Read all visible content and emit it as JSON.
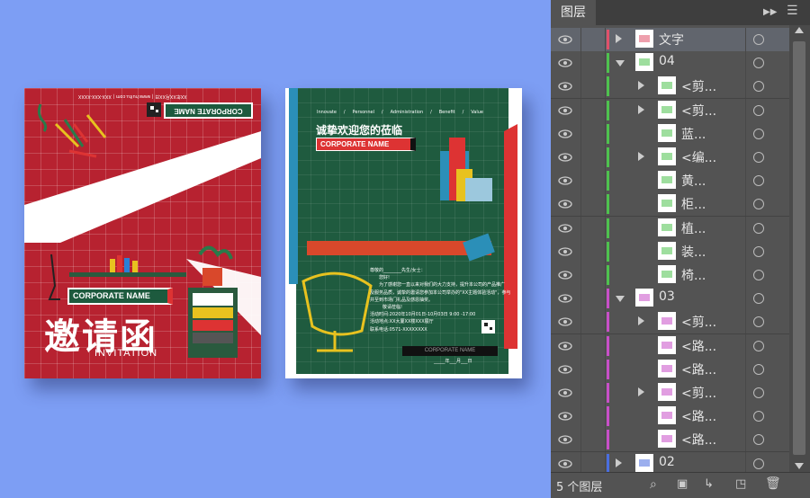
{
  "colors": {
    "background": "#7d9ef4",
    "red_card": "#b72230",
    "green_card": "#1f5b3f",
    "panel": "#535353"
  },
  "card_red": {
    "top_meta": "XX年XX月XX日 | www.huitu.com | XXX-XXX-XXXX",
    "corporate_label": "CORPORATE NAME",
    "corporate_label_2": "CORPORATE NAME",
    "title": "邀请函",
    "subtitle": "INVITATION"
  },
  "card_green": {
    "nav": [
      "Innovate",
      "/",
      "Personnel",
      "/",
      "Administration",
      "/",
      "Benefit",
      "/",
      "Value"
    ],
    "heading": "诚挚欢迎您的莅临",
    "corporate_label": "CORPORATE NAME",
    "body_lines": [
      "尊敬的________先生/女士：",
      "您好!",
      "为了感谢您一直以来对我们的大力支持，提升本公司的产品推广",
      "及服务品质，诚挚的邀请您参加本公司举办的\"XX主题体验活动\"，参与",
      "并至到市场门礼品及感恩抽奖。",
      "敬请莅临!",
      "活动时间:2020年10月01日-10月03日  9:00 -17:00",
      "活动地点:XX大厦XX楼XXX展厅",
      "联系电话:0571-XXXXXXXX"
    ],
    "footer_label": "CORPORATE NAME",
    "date_line": "_____年___月___日"
  },
  "layers_panel": {
    "tab_label": "图层",
    "footer_count": "5 个图层",
    "rows": [
      {
        "name": "文字",
        "expand": "right",
        "indent": 0,
        "color": "#e0506a",
        "selected": true
      },
      {
        "name": "04",
        "expand": "down",
        "indent": 0,
        "color": "#4ec24e",
        "selected": false
      },
      {
        "name": "<剪...",
        "expand": "right",
        "indent": 1,
        "color": "#4ec24e",
        "selected": false
      },
      {
        "name": "<剪...",
        "expand": "right",
        "indent": 1,
        "color": "#4ec24e",
        "selected": false
      },
      {
        "name": "蓝...",
        "expand": "none",
        "indent": 1,
        "color": "#4ec24e",
        "selected": false
      },
      {
        "name": "<编...",
        "expand": "right",
        "indent": 1,
        "color": "#4ec24e",
        "selected": false
      },
      {
        "name": "黄...",
        "expand": "none",
        "indent": 1,
        "color": "#4ec24e",
        "selected": false
      },
      {
        "name": "柜...",
        "expand": "none",
        "indent": 1,
        "color": "#4ec24e",
        "selected": false
      },
      {
        "name": "植...",
        "expand": "none",
        "indent": 1,
        "color": "#4ec24e",
        "selected": false
      },
      {
        "name": "装...",
        "expand": "none",
        "indent": 1,
        "color": "#4ec24e",
        "selected": false
      },
      {
        "name": "椅...",
        "expand": "none",
        "indent": 1,
        "color": "#4ec24e",
        "selected": false
      },
      {
        "name": "03",
        "expand": "down",
        "indent": 0,
        "color": "#c84fc8",
        "selected": false
      },
      {
        "name": "<剪...",
        "expand": "right",
        "indent": 1,
        "color": "#c84fc8",
        "selected": false
      },
      {
        "name": "<路...",
        "expand": "none",
        "indent": 1,
        "color": "#c84fc8",
        "selected": false
      },
      {
        "name": "<路...",
        "expand": "none",
        "indent": 1,
        "color": "#c84fc8",
        "selected": false
      },
      {
        "name": "<剪...",
        "expand": "right",
        "indent": 1,
        "color": "#c84fc8",
        "selected": false
      },
      {
        "name": "<路...",
        "expand": "none",
        "indent": 1,
        "color": "#c84fc8",
        "selected": false
      },
      {
        "name": "<路...",
        "expand": "none",
        "indent": 1,
        "color": "#c84fc8",
        "selected": false
      },
      {
        "name": "02",
        "expand": "right",
        "indent": 0,
        "color": "#4a6ee0",
        "selected": false
      }
    ]
  }
}
